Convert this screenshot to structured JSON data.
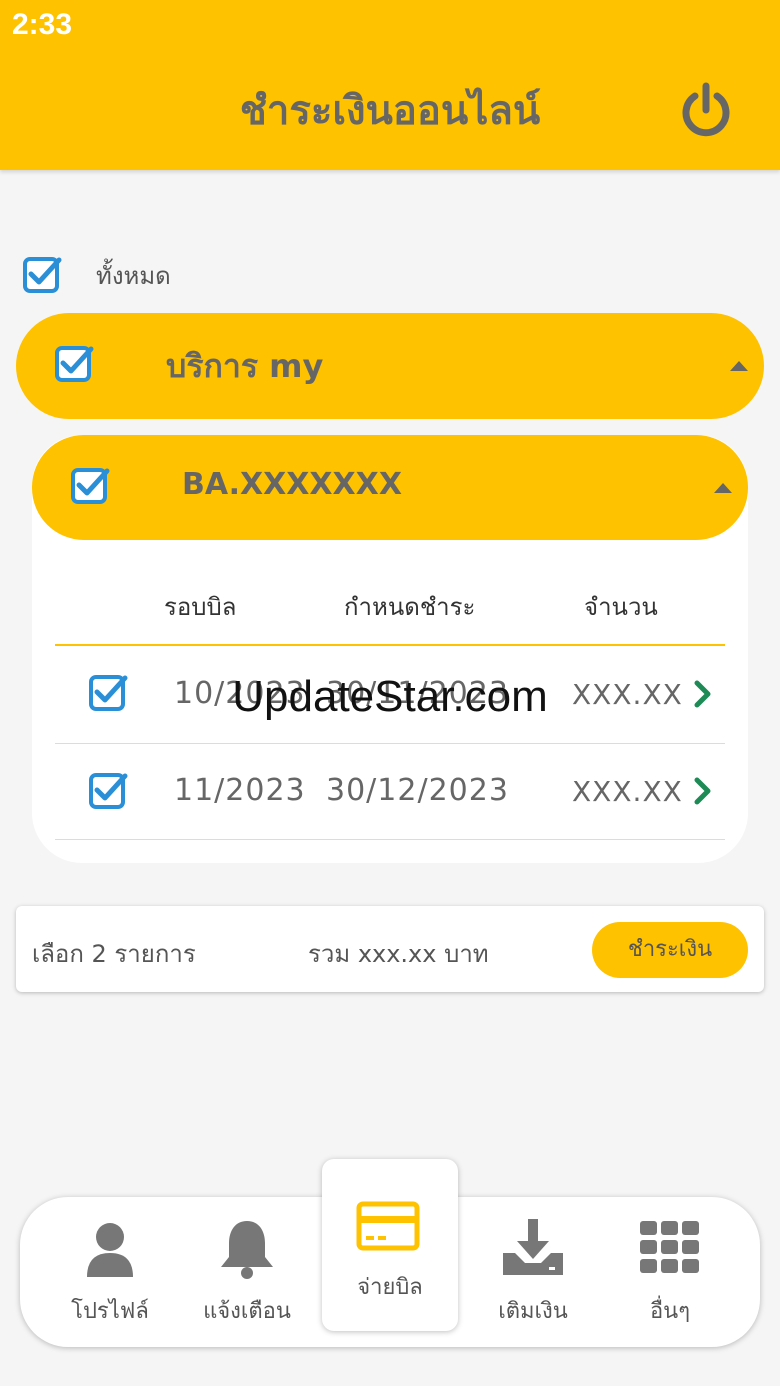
{
  "status_bar": {
    "time": "2:33"
  },
  "header": {
    "title": "ชำระเงินออนไลน์",
    "power_icon": "power-icon"
  },
  "select_all": {
    "label": "ทั้งหมด",
    "checked": true
  },
  "group": {
    "title": "บริการ my",
    "checked": true,
    "expanded": true
  },
  "account": {
    "title": "BA.XXXXXXX",
    "checked": true,
    "expanded": true
  },
  "table": {
    "columns": [
      "รอบบิล",
      "กำหนดชำระ",
      "จำนวน"
    ],
    "rows": [
      {
        "checked": true,
        "cycle": "10/2023",
        "due": "30/11/2023",
        "amount": "XXX.XX"
      },
      {
        "checked": true,
        "cycle": "11/2023",
        "due": "30/12/2023",
        "amount": "XXX.XX"
      }
    ]
  },
  "watermark": "UpdateStar.com",
  "summary": {
    "selected": "เลือก 2 รายการ",
    "total": "รวม xxx.xx บาท",
    "pay_button": "ชำระเงิน"
  },
  "bottom_nav": [
    {
      "label": "โปรไฟล์",
      "icon": "profile-icon",
      "active": false
    },
    {
      "label": "แจ้งเตือน",
      "icon": "bell-icon",
      "active": false
    },
    {
      "label": "จ่ายบิล",
      "icon": "card-icon",
      "active": true
    },
    {
      "label": "เติมเงิน",
      "icon": "download-icon",
      "active": false
    },
    {
      "label": "อื่นๆ",
      "icon": "grid-icon",
      "active": false
    }
  ],
  "colors": {
    "accent": "#fec200",
    "checkbox": "#2a8fd6",
    "chevron": "#1e8a55",
    "text": "#666666"
  }
}
